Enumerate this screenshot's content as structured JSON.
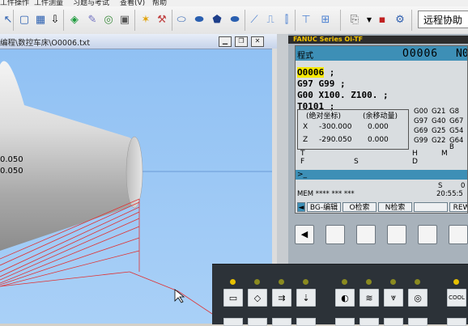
{
  "menu": {
    "items": [
      "工件操作",
      "工件测量",
      "习题与考试",
      "查看(V)",
      "帮助"
    ]
  },
  "toolbar": {
    "remote_label": "远程协助"
  },
  "viewport": {
    "title": "编程\\数控车床\\O0006.txt",
    "coord1": "0.050",
    "coord2": "0.050"
  },
  "cnc": {
    "brand": "FANUC Series Oi-TF",
    "header_left": "程式",
    "header_prog": "O0006",
    "header_right": "N0",
    "program_lines": [
      "O0006 ;",
      "G97 G99 ;",
      "G00 X100. Z100. ;",
      "T0101 ;"
    ],
    "cursor_text": "O0006",
    "coord_abs_label": "(绝对坐标)",
    "coord_rel_label": "(余移动量)",
    "x_label": "X",
    "z_label": "Z",
    "x_abs": "-300.000",
    "z_abs": "-290.050",
    "x_rel": "0.000",
    "z_rel": "0.000",
    "gcodes": [
      [
        "G00",
        "G21",
        "G8"
      ],
      [
        "G97",
        "G40",
        "G67"
      ],
      [
        "G69",
        "G25",
        "G54"
      ],
      [
        "G99",
        "G22",
        "G64"
      ]
    ],
    "gcode_b": "B",
    "label_t": "T",
    "label_f": "F",
    "label_s": "S",
    "label_h": "H",
    "label_d": "D",
    "label_m": "M",
    "input_prompt": ">_",
    "s_value": "S",
    "t_value": "0",
    "mode_status": "MEM **** ***    ***",
    "time": "20:55:5",
    "softkeys": [
      "BG-编辑",
      "O检索",
      "N检索",
      "",
      "REW"
    ],
    "softkey_prev": "◀",
    "softkey_prev_label": "◄"
  },
  "panel": {
    "cool_label": "COOL"
  }
}
